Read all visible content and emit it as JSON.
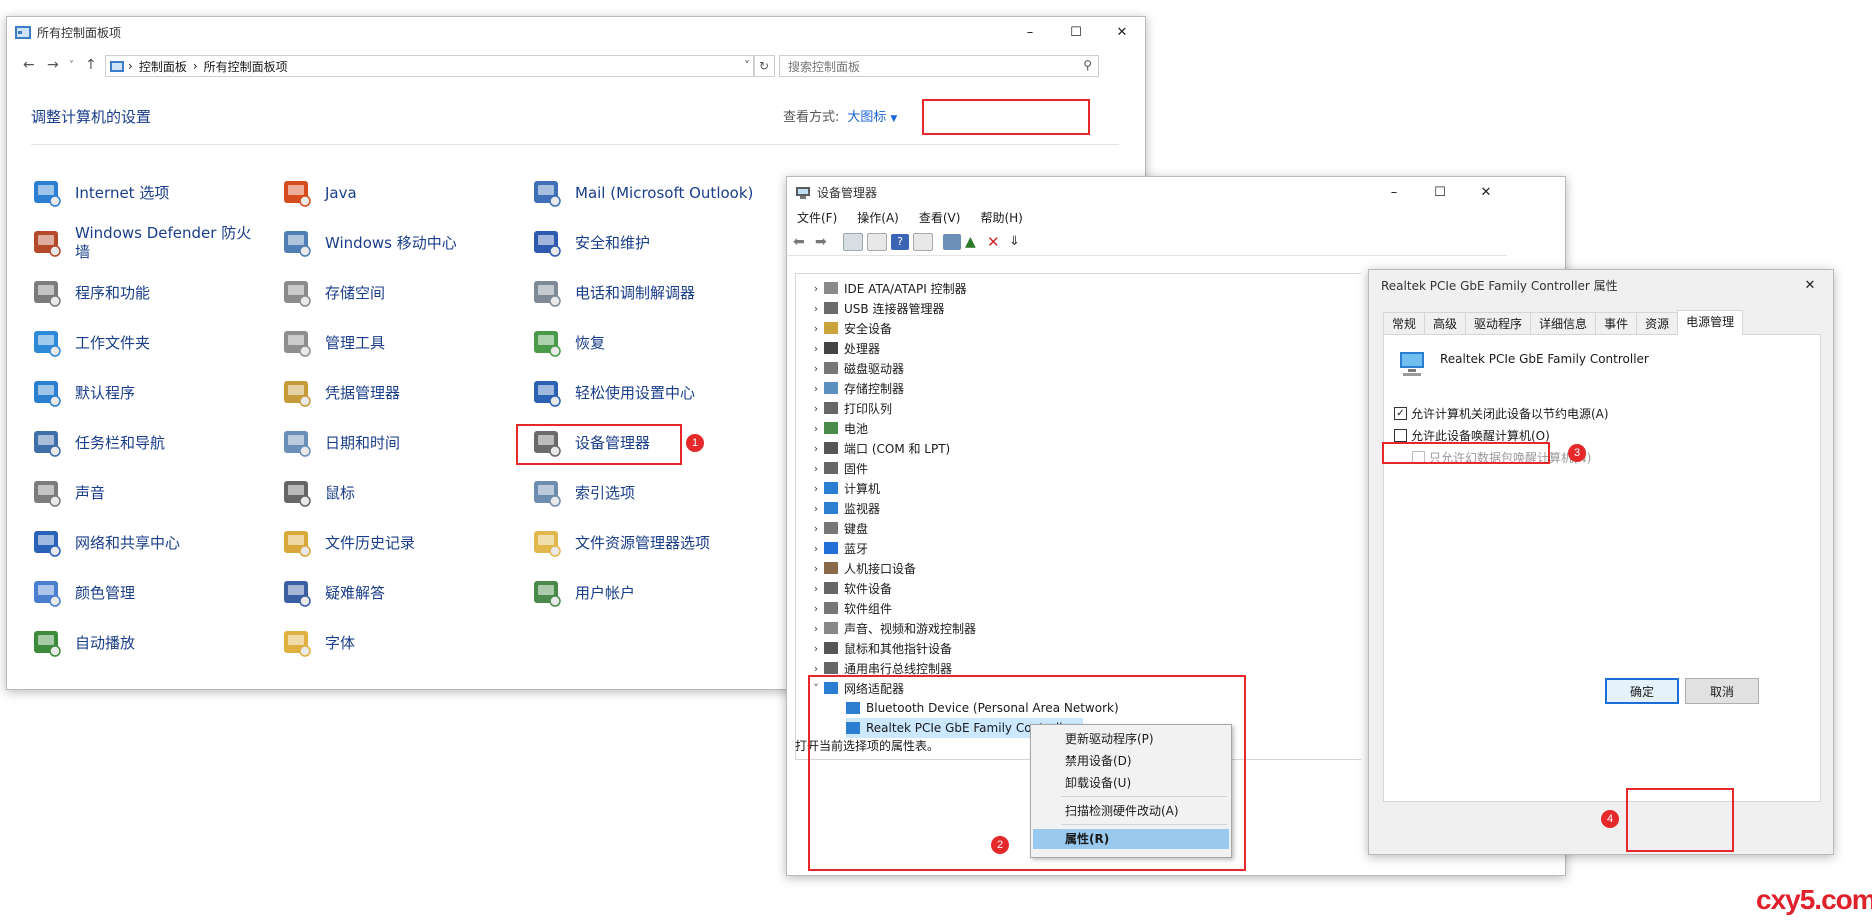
{
  "control_panel": {
    "title": "所有控制面板项",
    "breadcrumb": [
      "控制面板",
      "所有控制面板项"
    ],
    "search_placeholder": "搜索控制面板",
    "heading": "调整计算机的设置",
    "view_by_label": "查看方式:",
    "view_by_value": "大图标",
    "items": [
      {
        "label": "Internet 选项",
        "icon": "globe-icon",
        "color": "#2d7fd3"
      },
      {
        "label": "Java",
        "icon": "java-icon",
        "color": "#d54d1c"
      },
      {
        "label": "Mail (Microsoft Outlook)",
        "icon": "mail-icon",
        "color": "#3e6fb7"
      },
      {
        "label": "Windows Defender 防火墙",
        "icon": "firewall-icon",
        "color": "#b44a2a"
      },
      {
        "label": "Windows 移动中心",
        "icon": "mobility-center-icon",
        "color": "#4f7fb4"
      },
      {
        "label": "安全和维护",
        "icon": "flag-icon",
        "color": "#2f5ab0"
      },
      {
        "label": "程序和功能",
        "icon": "programs-icon",
        "color": "#7b7b7b"
      },
      {
        "label": "存储空间",
        "icon": "storage-icon",
        "color": "#8b8b8b"
      },
      {
        "label": "电话和调制解调器",
        "icon": "phone-icon",
        "color": "#7e8a96"
      },
      {
        "label": "工作文件夹",
        "icon": "folder-icon",
        "color": "#2e8ad6"
      },
      {
        "label": "管理工具",
        "icon": "admin-tools-icon",
        "color": "#8e8e8e"
      },
      {
        "label": "恢复",
        "icon": "recovery-icon",
        "color": "#4a9a4a"
      },
      {
        "label": "默认程序",
        "icon": "default-programs-icon",
        "color": "#2b7fcf"
      },
      {
        "label": "凭据管理器",
        "icon": "credential-icon",
        "color": "#c59a3a"
      },
      {
        "label": "轻松使用设置中心",
        "icon": "ease-of-access-icon",
        "color": "#2c62b4"
      },
      {
        "label": "任务栏和导航",
        "icon": "taskbar-icon",
        "color": "#3f6fa8"
      },
      {
        "label": "日期和时间",
        "icon": "clock-icon",
        "color": "#6a8fb8"
      },
      {
        "label": "设备管理器",
        "icon": "device-manager-icon",
        "color": "#6b6b6b"
      },
      {
        "label": "声音",
        "icon": "speaker-icon",
        "color": "#7c7c7c"
      },
      {
        "label": "鼠标",
        "icon": "mouse-icon",
        "color": "#666666"
      },
      {
        "label": "索引选项",
        "icon": "index-icon",
        "color": "#6c8cb0"
      },
      {
        "label": "网络和共享中心",
        "icon": "network-icon",
        "color": "#2a62b8"
      },
      {
        "label": "文件历史记录",
        "icon": "file-history-icon",
        "color": "#d8a83a"
      },
      {
        "label": "文件资源管理器选项",
        "icon": "explorer-options-icon",
        "color": "#e2b84c"
      },
      {
        "label": "颜色管理",
        "icon": "color-icon",
        "color": "#4a7fd0"
      },
      {
        "label": "疑难解答",
        "icon": "troubleshoot-icon",
        "color": "#3b5fa2"
      },
      {
        "label": "用户帐户",
        "icon": "users-icon",
        "color": "#4a8a4a"
      },
      {
        "label": "自动播放",
        "icon": "autoplay-icon",
        "color": "#3d8c3d"
      },
      {
        "label": "字体",
        "icon": "fonts-icon",
        "color": "#e0b040"
      }
    ]
  },
  "device_manager": {
    "title": "设备管理器",
    "menu": [
      "文件(F)",
      "操作(A)",
      "查看(V)",
      "帮助(H)"
    ],
    "tree": [
      {
        "label": "IDE ATA/ATAPI 控制器",
        "expanded": false
      },
      {
        "label": "USB 连接器管理器",
        "expanded": false
      },
      {
        "label": "安全设备",
        "expanded": false
      },
      {
        "label": "处理器",
        "expanded": false
      },
      {
        "label": "磁盘驱动器",
        "expanded": false
      },
      {
        "label": "存储控制器",
        "expanded": false
      },
      {
        "label": "打印队列",
        "expanded": false
      },
      {
        "label": "电池",
        "expanded": false
      },
      {
        "label": "端口 (COM 和 LPT)",
        "expanded": false
      },
      {
        "label": "固件",
        "expanded": false
      },
      {
        "label": "计算机",
        "expanded": false
      },
      {
        "label": "监视器",
        "expanded": false
      },
      {
        "label": "键盘",
        "expanded": false
      },
      {
        "label": "蓝牙",
        "expanded": false
      },
      {
        "label": "人机接口设备",
        "expanded": false
      },
      {
        "label": "软件设备",
        "expanded": false
      },
      {
        "label": "软件组件",
        "expanded": false
      },
      {
        "label": "声音、视频和游戏控制器",
        "expanded": false
      },
      {
        "label": "鼠标和其他指针设备",
        "expanded": false
      },
      {
        "label": "通用串行总线控制器",
        "expanded": false
      },
      {
        "label": "网络适配器",
        "expanded": true
      }
    ],
    "network_children": [
      "Bluetooth Device (Personal Area Network)",
      "Realtek PCIe GbE Family Controller"
    ],
    "status": "打开当前选择项的属性表。",
    "context_menu": [
      "更新驱动程序(P)",
      "禁用设备(D)",
      "卸载设备(U)",
      "扫描检测硬件改动(A)",
      "属性(R)"
    ]
  },
  "properties": {
    "title": "Realtek PCIe GbE Family Controller 属性",
    "tabs": [
      "常规",
      "高级",
      "驱动程序",
      "详细信息",
      "事件",
      "资源",
      "电源管理"
    ],
    "device_name": "Realtek PCIe GbE Family Controller",
    "options": [
      {
        "label": "允许计算机关闭此设备以节约电源(A)",
        "checked": true,
        "disabled": false
      },
      {
        "label": "允许此设备唤醒计算机(O)",
        "checked": false,
        "disabled": false
      },
      {
        "label": "只允许幻数据包唤醒计算机(N)",
        "checked": false,
        "disabled": true
      }
    ],
    "ok": "确定",
    "cancel": "取消"
  },
  "annotations": [
    "1",
    "2",
    "3",
    "4"
  ],
  "watermark": "cxy5.com",
  "colors": {
    "highlight": "#e6282b",
    "link": "#1a3e8a",
    "accent": "#1c63d6",
    "selection": "#99c9ef"
  }
}
